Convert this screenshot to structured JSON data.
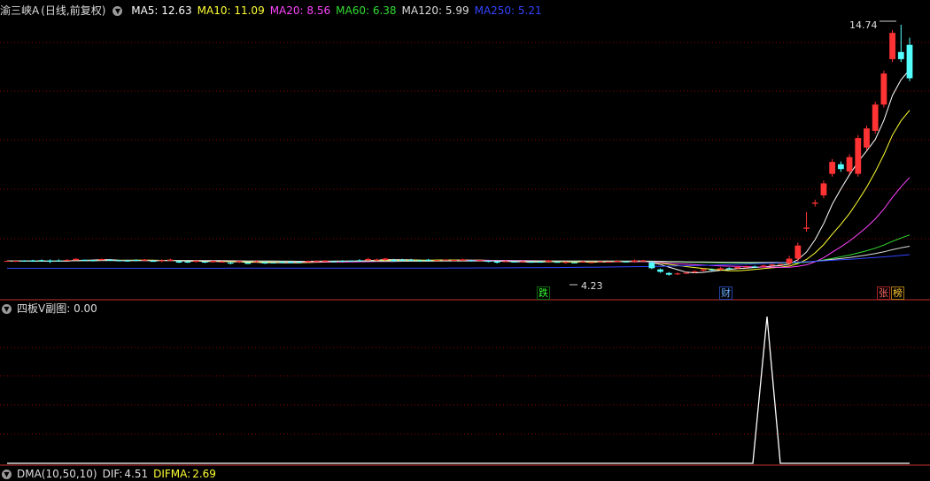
{
  "main_header": {
    "stock": "渝三峡A",
    "period": "(日线,前复权)",
    "ma": [
      {
        "label": "MA5:",
        "value": "12.63",
        "color": "#ffffff"
      },
      {
        "label": "MA10:",
        "value": "11.09",
        "color": "#ffff33"
      },
      {
        "label": "MA20:",
        "value": "8.56",
        "color": "#ff44ff"
      },
      {
        "label": "MA60:",
        "value": "6.38",
        "color": "#33dd33"
      },
      {
        "label": "MA120:",
        "value": "5.99",
        "color": "#dddddd"
      },
      {
        "label": "MA250:",
        "value": "5.21",
        "color": "#3344ff"
      }
    ]
  },
  "annotations": {
    "high": "14.74",
    "low": "4.23",
    "badge_die": "跌",
    "badge_cai": "财",
    "badge_zhang": "张",
    "badge_bang": "榜"
  },
  "sub_header": {
    "title": "四板V副图",
    "value": ": 0.00"
  },
  "dma_header": {
    "title": "DMA(10,50,10)",
    "dif_label": "DIF:",
    "dif_value": "4.51",
    "difma_label": "DIFMA:",
    "difma_value": "2.69"
  },
  "colors": {
    "up": "#ff3333",
    "down": "#54ffff",
    "grid": "#8b0000",
    "divider": "#c03030"
  },
  "chart_data": {
    "type": "candlestick",
    "price_levels": {
      "high": 14.74,
      "low": 4.23,
      "ma5": 12.63,
      "ma10": 11.09,
      "ma20": 8.56,
      "ma60": 6.38,
      "ma120": 5.99,
      "ma250": 5.21
    },
    "indicator": {
      "name": "四板V副图",
      "value": 0.0,
      "spike_value": 1.0
    }
  }
}
